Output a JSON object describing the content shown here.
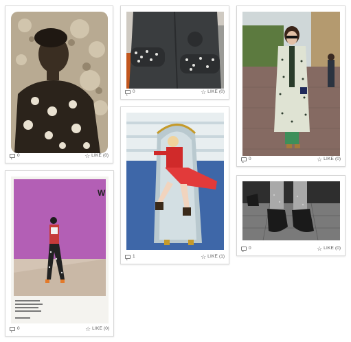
{
  "cards": [
    {
      "comments": "0",
      "like_label": "LIKE",
      "like_count": "(0)"
    },
    {
      "comments": "0",
      "like_label": "LIKE",
      "like_count": "(0)"
    },
    {
      "comments": "0",
      "like_label": "LIKE",
      "like_count": "(0)"
    },
    {
      "comments": "1",
      "like_label": "LIKE",
      "like_count": "(1)"
    },
    {
      "comments": "0",
      "like_label": "LIKE",
      "like_count": "(0)"
    },
    {
      "comments": "0",
      "like_label": "LIKE",
      "like_count": "(0)"
    }
  ],
  "icons": {
    "comment": "comment-bubble-icon",
    "like": "star-icon"
  },
  "colors": {
    "card_border": "#d6d6d6",
    "meta_text": "#555555"
  }
}
